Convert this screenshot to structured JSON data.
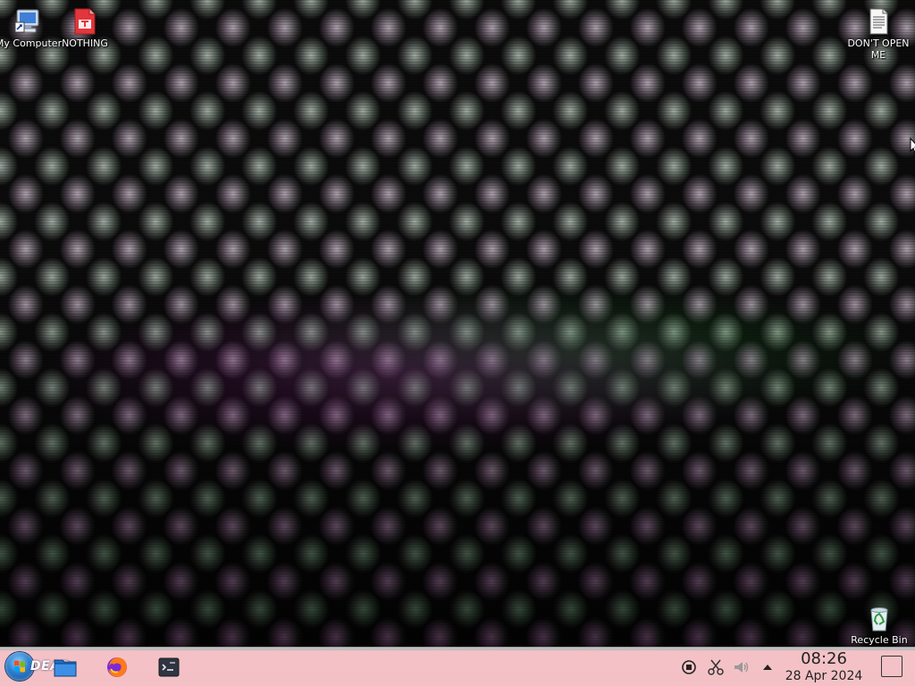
{
  "desktop": {
    "wallpaper": "glitch-skulls",
    "icons": [
      {
        "label": "My Computer",
        "icon": "computer-icon"
      },
      {
        "label": "NOTHING",
        "icon": "pdf-document-icon"
      },
      {
        "label": "DON'T OPEN ME",
        "icon": "text-document-icon"
      },
      {
        "label": "Recycle Bin",
        "icon": "recycle-bin-icon"
      }
    ]
  },
  "taskbar": {
    "start_label": "DEAD",
    "launchers": [
      "file-manager-icon",
      "firefox-icon",
      "terminal-icon"
    ],
    "tray": [
      "network-icon",
      "clipboard-icon",
      "volume-icon",
      "tray-expand-icon"
    ],
    "clock": {
      "time": "08:26",
      "date": "28 Apr 2024"
    },
    "show_desktop": "show-desktop-icon",
    "colors": {
      "taskbar_bg": "#f3c1c5",
      "clock_text": "#222222",
      "start_orb": "#2a7fd0"
    }
  }
}
